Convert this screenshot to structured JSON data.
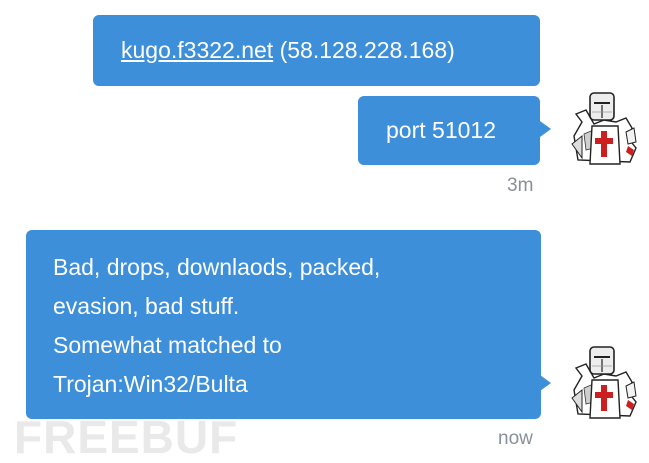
{
  "messages": [
    {
      "link": "kugo.f3322.net",
      "text": " (58.128.228.168)"
    },
    {
      "text": "port 51012",
      "time": "3m"
    },
    {
      "lines": [
        "Bad, drops, downlaods, packed,",
        "evasion, bad stuff.",
        "Somewhat matched to",
        "Trojan:Win32/Bulta"
      ],
      "time": "now"
    }
  ],
  "watermark": "FREEBUF",
  "colors": {
    "bubble": "#3d8fd9",
    "timestamp": "#8a9099",
    "cross": "#cc1f1f"
  },
  "icons": {
    "avatar": "crusader-knight-icon"
  }
}
